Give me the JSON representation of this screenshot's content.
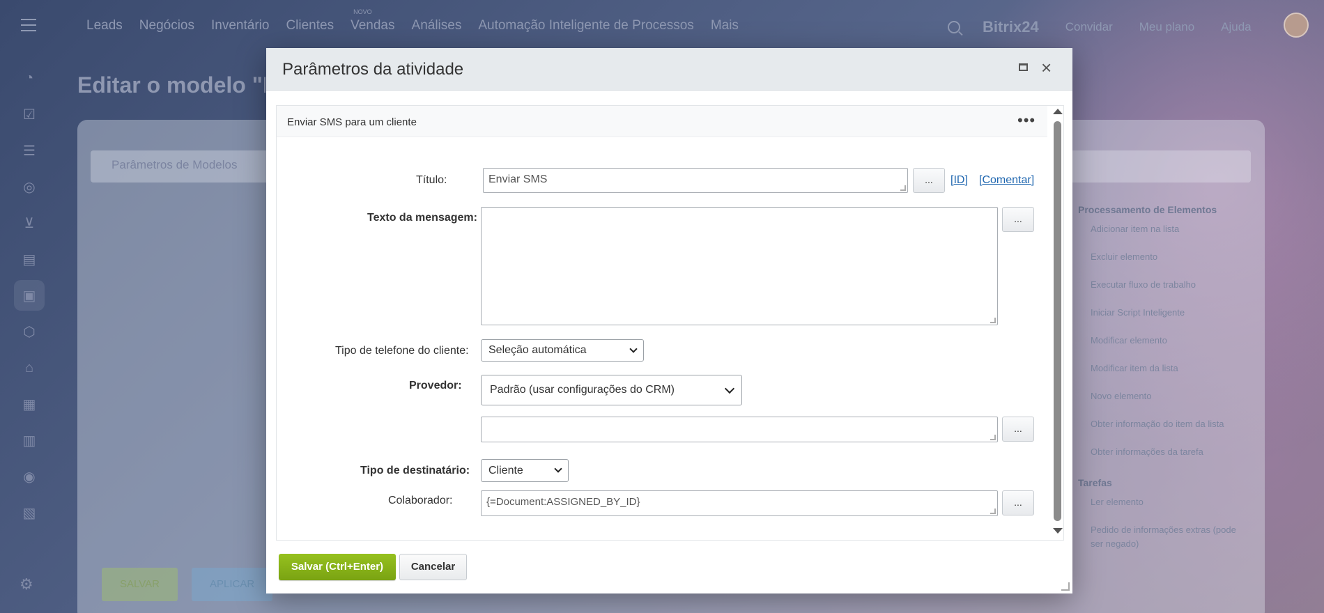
{
  "background": {
    "nav": [
      "Leads",
      "Negócios",
      "Inventário",
      "Clientes",
      "Vendas",
      "Análises",
      "Automação Inteligente de Processos",
      "Mais"
    ],
    "novo_badge": "NOVO",
    "brand": "Bitrix24",
    "top_links": [
      "Convidar",
      "Meu plano",
      "Ajuda"
    ],
    "page_title": "Editar o modelo \"N",
    "tab_label": "Parâmetros de Modelos",
    "right_panel": {
      "section1": "Processamento de Elementos",
      "items1": [
        "Adicionar item na lista",
        "Excluir elemento",
        "Executar fluxo de trabalho",
        "Iniciar Script Inteligente",
        "Modificar elemento",
        "Modificar item da lista",
        "Novo elemento",
        "Obter informação do item da lista",
        "Obter informações da tarefa"
      ],
      "section2": "Tarefas",
      "items2": [
        "Ler elemento",
        "Pedido de informações extras (pode ser negado)"
      ]
    },
    "save_button": "SALVAR",
    "apply_button": "APLICAR"
  },
  "dialog": {
    "title": "Parâmetros da atividade",
    "activity_name": "Enviar SMS para um cliente",
    "fields": {
      "title_label": "Título:",
      "title_value": "Enviar SMS",
      "id_link": "ID",
      "comment_link": "Comentar",
      "message_label": "Texto da mensagem:",
      "message_value": "",
      "phone_type_label": "Tipo de telefone do cliente:",
      "phone_type_value": "Seleção automática",
      "provider_label": "Provedor:",
      "provider_value": "Padrão (usar configurações do CRM)",
      "provider_extra_value": "",
      "recipient_type_label": "Tipo de destinatário:",
      "recipient_type_value": "Cliente",
      "employee_label": "Colaborador:",
      "employee_value": "{=Document:ASSIGNED_BY_ID}",
      "dots": "..."
    },
    "save_button": "Salvar (Ctrl+Enter)",
    "cancel_button": "Cancelar"
  }
}
